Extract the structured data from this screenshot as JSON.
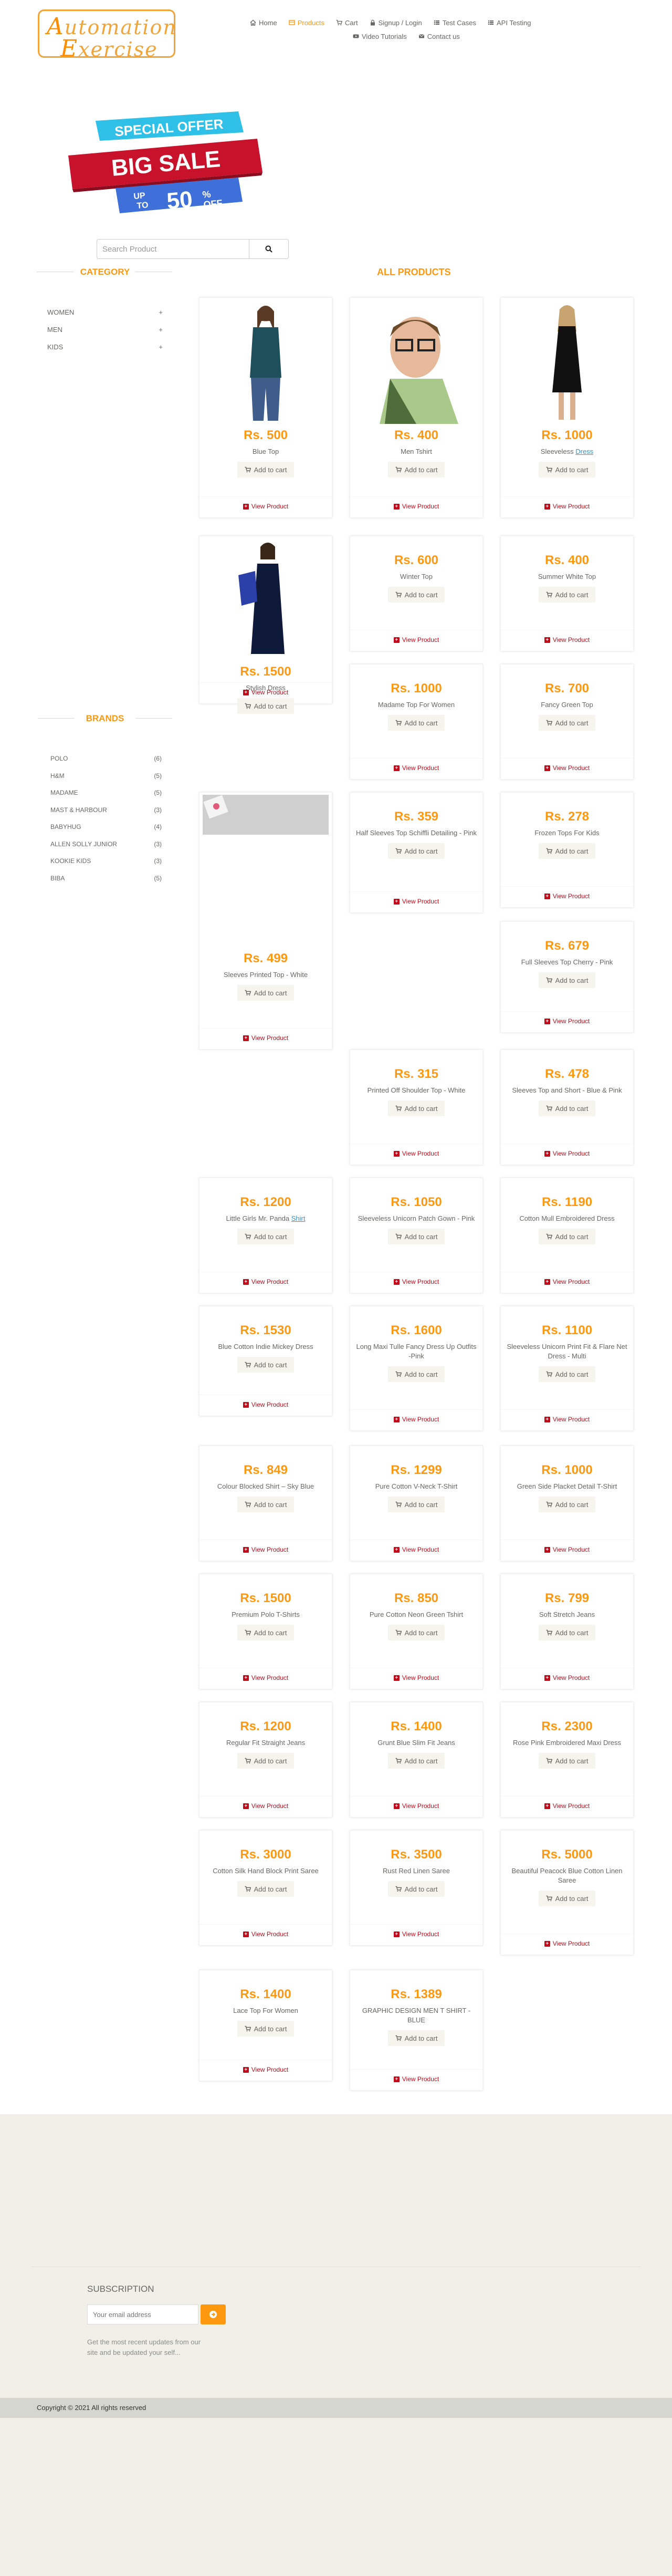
{
  "header": {
    "logo_line1_cap": "A",
    "logo_line1_rest": "utomation",
    "logo_line2_cap": "E",
    "logo_line2_rest": "xercise",
    "nav": [
      {
        "label": "Home",
        "icon": "home-icon"
      },
      {
        "label": "Products",
        "icon": "products-icon",
        "active": true
      },
      {
        "label": "Cart",
        "icon": "cart-icon"
      },
      {
        "label": "Signup / Login",
        "icon": "lock-icon"
      },
      {
        "label": "Test Cases",
        "icon": "list-icon"
      },
      {
        "label": "API Testing",
        "icon": "list-icon"
      },
      {
        "label": "Video Tutorials",
        "icon": "youtube-icon"
      },
      {
        "label": "Contact us",
        "icon": "envelope-icon"
      }
    ]
  },
  "banner": {
    "special_offer": "SPECIAL OFFER",
    "big_sale": "BIG SALE",
    "up_to": "UP",
    "to": "TO",
    "percent": "50",
    "pct_sign": "%",
    "off": "OFF"
  },
  "search": {
    "placeholder": "Search Product"
  },
  "sidebar": {
    "category_title": "CATEGORY",
    "categories": [
      "Women",
      "Men",
      "Kids"
    ],
    "brands_title": "BRANDS",
    "brands": [
      {
        "name": "Polo",
        "count": "(6)"
      },
      {
        "name": "H&M",
        "count": "(5)"
      },
      {
        "name": "Madame",
        "count": "(5)"
      },
      {
        "name": "Mast & Harbour",
        "count": "(3)"
      },
      {
        "name": "Babyhug",
        "count": "(4)"
      },
      {
        "name": "Allen Solly Junior",
        "count": "(3)"
      },
      {
        "name": "Kookie Kids",
        "count": "(3)"
      },
      {
        "name": "Biba",
        "count": "(5)"
      }
    ]
  },
  "products_title": "ALL PRODUCTS",
  "add_to_cart": "Add to cart",
  "view_product": "View Product",
  "products": [
    {
      "price": "Rs. 500",
      "name": "Blue Top"
    },
    {
      "price": "Rs. 400",
      "name": "Men Tshirt"
    },
    {
      "price": "Rs. 1000",
      "name": "Sleeveless ",
      "link": "Dress"
    },
    {
      "price": "Rs. 1500",
      "name": "Stylish Dress"
    },
    {
      "price": "Rs. 600",
      "name": "Winter Top"
    },
    {
      "price": "Rs. 400",
      "name": "Summer White Top"
    },
    {
      "price": "Rs. 1000",
      "name": "Madame Top For Women"
    },
    {
      "price": "Rs. 700",
      "name": "Fancy Green Top"
    },
    {
      "price": "Rs. 499",
      "name": "Sleeves Printed Top - White"
    },
    {
      "price": "Rs. 359",
      "name": "Half Sleeves Top Schiffli Detailing - Pink"
    },
    {
      "price": "Rs. 278",
      "name": "Frozen Tops For Kids"
    },
    {
      "price": "Rs. 679",
      "name": "Full Sleeves Top Cherry - Pink"
    },
    {
      "price": "Rs. 315",
      "name": "Printed Off Shoulder Top - White"
    },
    {
      "price": "Rs. 478",
      "name": "Sleeves Top and Short - Blue & Pink"
    },
    {
      "price": "Rs. 1200",
      "name": "Little Girls Mr. Panda ",
      "link": "Shirt"
    },
    {
      "price": "Rs. 1050",
      "name": "Sleeveless Unicorn Patch Gown - Pink"
    },
    {
      "price": "Rs. 1190",
      "name": "Cotton Mull Embroidered Dress"
    },
    {
      "price": "Rs. 1530",
      "name": "Blue Cotton Indie Mickey Dress"
    },
    {
      "price": "Rs. 1600",
      "name": "Long Maxi Tulle Fancy Dress Up Outfits -Pink"
    },
    {
      "price": "Rs. 1100",
      "name": "Sleeveless Unicorn Print Fit & Flare Net Dress - Multi"
    },
    {
      "price": "Rs. 849",
      "name": "Colour Blocked Shirt – Sky Blue"
    },
    {
      "price": "Rs. 1299",
      "name": "Pure Cotton V-Neck T-Shirt"
    },
    {
      "price": "Rs. 1000",
      "name": "Green Side Placket Detail T-Shirt"
    },
    {
      "price": "Rs. 1500",
      "name": "Premium Polo T-Shirts"
    },
    {
      "price": "Rs. 850",
      "name": "Pure Cotton Neon Green Tshirt"
    },
    {
      "price": "Rs. 799",
      "name": "Soft Stretch Jeans"
    },
    {
      "price": "Rs. 1200",
      "name": "Regular Fit Straight Jeans"
    },
    {
      "price": "Rs. 1400",
      "name": "Grunt Blue Slim Fit Jeans"
    },
    {
      "price": "Rs. 2300",
      "name": "Rose Pink Embroidered Maxi Dress"
    },
    {
      "price": "Rs. 3000",
      "name": "Cotton Silk Hand Block Print Saree"
    },
    {
      "price": "Rs. 3500",
      "name": "Rust Red Linen Saree"
    },
    {
      "price": "Rs. 5000",
      "name": "Beautiful Peacock Blue Cotton Linen Saree"
    },
    {
      "price": "Rs. 1400",
      "name": "Lace Top For Women"
    },
    {
      "price": "Rs. 1389",
      "name": "GRAPHIC DESIGN MEN T SHIRT - BLUE"
    }
  ],
  "footer": {
    "subscription_title": "SUBSCRIPTION",
    "email_placeholder": "Your email address",
    "subscription_text": "Get the most recent updates from our site and be updated your self...",
    "copyright": "Copyright © 2021 All rights reserved"
  },
  "colors": {
    "accent": "#fe980f",
    "view_product": "#c20b1a",
    "footer_bg": "#f0f0e9"
  }
}
